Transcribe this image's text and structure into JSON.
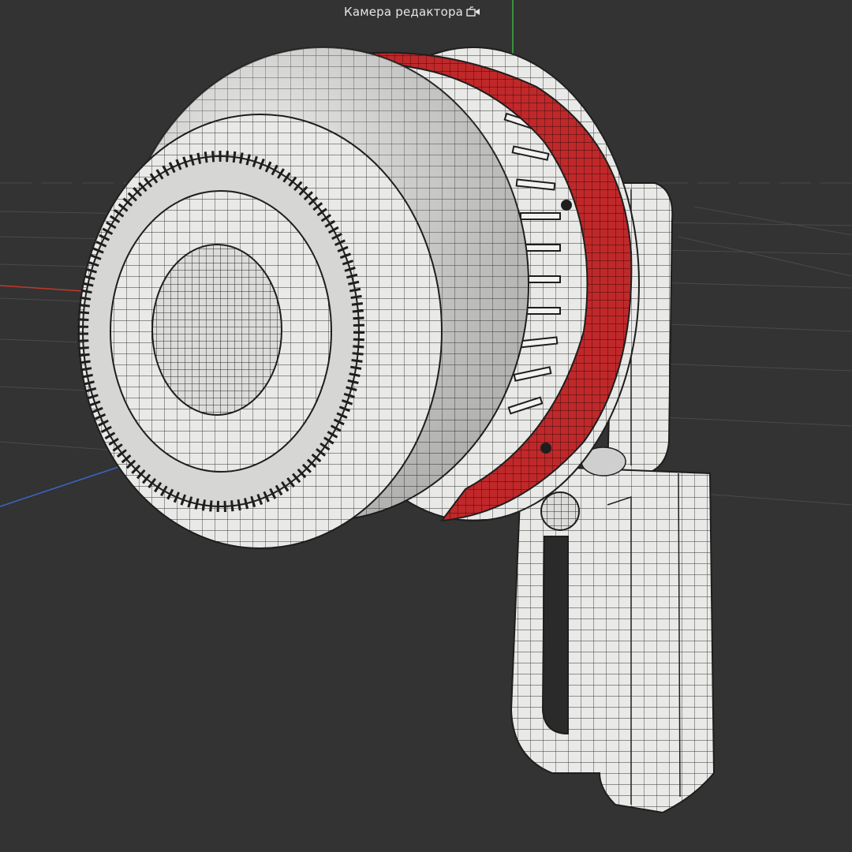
{
  "viewport": {
    "camera_label": "Камера редактора",
    "camera_icon": "camera-icon",
    "background_color": "#333333",
    "grid_color": "#4a4a4a",
    "axis_colors": {
      "x": "#c0392b",
      "y": "#3cb043",
      "z": "#3a66c8"
    }
  },
  "model": {
    "body_color": "#e8e8e6",
    "band_color": "#c0282a",
    "wire_color": "#1e1e1e"
  }
}
